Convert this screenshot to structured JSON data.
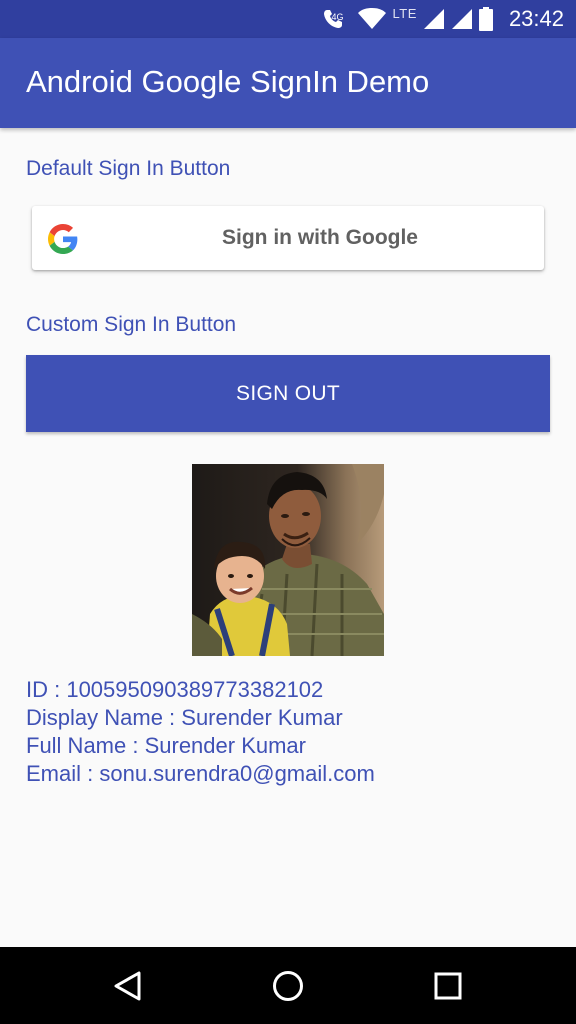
{
  "status_bar": {
    "network_badge": "4G",
    "lte_label": "LTE",
    "time": "23:42"
  },
  "app_bar": {
    "title": "Android Google SignIn Demo"
  },
  "default_section": {
    "label": "Default Sign In Button",
    "google_button_label": "Sign in with Google"
  },
  "custom_section": {
    "label": "Custom Sign In Button",
    "button_label": "SIGN OUT"
  },
  "profile": {
    "id_line": "ID : 100595090389773382102",
    "display_name_line": "Display Name : Surender Kumar",
    "full_name_line": "Full Name : Surender Kumar",
    "email_line": "Email : sonu.surendra0@gmail.com"
  },
  "icons": {
    "call": "wifi-call-icon",
    "wifi": "wifi-icon",
    "signal": "cell-signal-icon",
    "battery": "battery-icon",
    "google": "google-g-icon",
    "back": "back-icon",
    "home": "home-icon",
    "recents": "recents-icon"
  },
  "colors": {
    "status_bar": "#303f9f",
    "primary": "#3f51b5",
    "background": "#fafafa",
    "nav_bar": "#000000"
  }
}
